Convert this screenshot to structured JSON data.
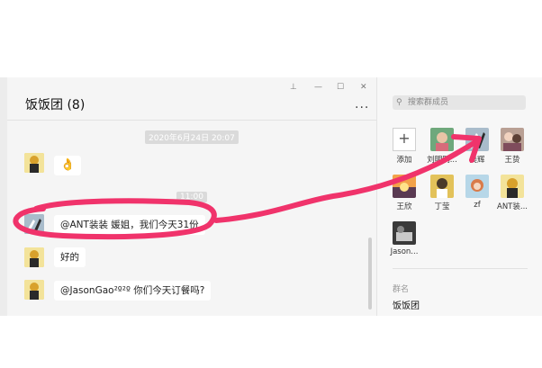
{
  "chat": {
    "title": "饭饭团 (8)",
    "more_label": "...",
    "window_controls": [
      "⊥",
      "—",
      "☐",
      "✕"
    ],
    "timestamps": [
      "2020年6月24日 20:07",
      "11:00"
    ],
    "messages": [
      {
        "text": "👌"
      },
      {
        "text": "@ANT装装 媛姐，我们今天31份"
      },
      {
        "text": "好的"
      },
      {
        "text": "@JasonGao²º²º 你们今天订餐吗?"
      }
    ]
  },
  "panel": {
    "search_placeholder": "搜索群成员",
    "search_icon": "search-icon",
    "add_label": "添加",
    "members": [
      {
        "name": "刘明明..."
      },
      {
        "name": "美辉"
      },
      {
        "name": "王贽"
      },
      {
        "name": "王欣"
      },
      {
        "name": "丁莹"
      },
      {
        "name": "zf"
      },
      {
        "name": "ANT装..."
      },
      {
        "name": "Jason..."
      }
    ],
    "group_label": "群名",
    "group_name": "饭饭团"
  },
  "colors": {
    "annotation": "#f0336b",
    "bubble": "#ffffff",
    "background": "#f5f5f5"
  }
}
